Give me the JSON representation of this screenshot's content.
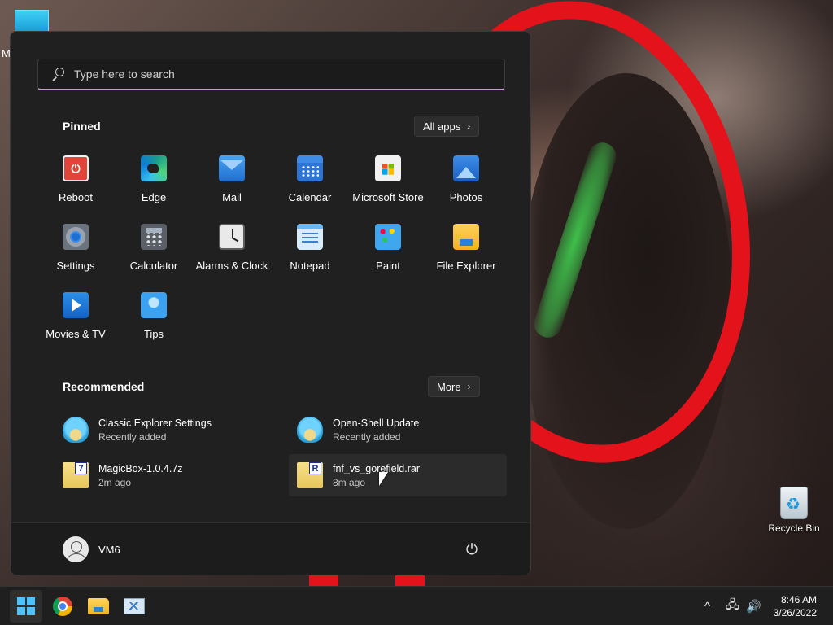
{
  "desktop": {
    "partial_icon_label": "M",
    "recycle_bin_label": "Recycle Bin"
  },
  "start_menu": {
    "search": {
      "placeholder": "Type here to search"
    },
    "pinned": {
      "title": "Pinned",
      "all_apps_label": "All apps",
      "apps": [
        {
          "label": "Reboot",
          "icon": "reboot-icon"
        },
        {
          "label": "Edge",
          "icon": "edge-icon"
        },
        {
          "label": "Mail",
          "icon": "mail-icon"
        },
        {
          "label": "Calendar",
          "icon": "calendar-icon"
        },
        {
          "label": "Microsoft Store",
          "icon": "store-icon"
        },
        {
          "label": "Photos",
          "icon": "photos-icon"
        },
        {
          "label": "Settings",
          "icon": "settings-icon"
        },
        {
          "label": "Calculator",
          "icon": "calculator-icon"
        },
        {
          "label": "Alarms & Clock",
          "icon": "clock-icon"
        },
        {
          "label": "Notepad",
          "icon": "notepad-icon"
        },
        {
          "label": "Paint",
          "icon": "paint-icon"
        },
        {
          "label": "File Explorer",
          "icon": "folder-icon"
        },
        {
          "label": "Movies & TV",
          "icon": "movies-icon"
        },
        {
          "label": "Tips",
          "icon": "tips-icon"
        }
      ]
    },
    "recommended": {
      "title": "Recommended",
      "more_label": "More",
      "items": [
        {
          "name": "Classic Explorer Settings",
          "sub": "Recently added",
          "icon": "open-shell-icon"
        },
        {
          "name": "Open-Shell Update",
          "sub": "Recently added",
          "icon": "open-shell-icon"
        },
        {
          "name": "MagicBox-1.0.4.7z",
          "sub": "2m ago",
          "icon": "7z-archive-icon",
          "badge": "7"
        },
        {
          "name": "fnf_vs_gorefield.rar",
          "sub": "8m ago",
          "icon": "rar-archive-icon",
          "badge": "R"
        }
      ]
    },
    "user": {
      "name": "VM6"
    },
    "chevron": "›",
    "power_glyph": "⏻"
  },
  "taskbar": {
    "apps": [
      {
        "name": "start-button",
        "icon": "windows-icon"
      },
      {
        "name": "chrome-button",
        "icon": "chrome-icon"
      },
      {
        "name": "file-explorer-button",
        "icon": "folder-icon"
      },
      {
        "name": "resource-monitor-button",
        "icon": "monitor-icon"
      }
    ],
    "tray": {
      "chevron": "^",
      "network": "🖧",
      "volume": "🔊"
    },
    "clock": {
      "time": "8:46 AM",
      "date": "3/26/2022"
    }
  },
  "colors": {
    "menu_bg": "#202020",
    "taskbar_bg": "#1f1f1f",
    "search_accent": "#c79bd6",
    "windows_blue": "#4cc2ff"
  }
}
